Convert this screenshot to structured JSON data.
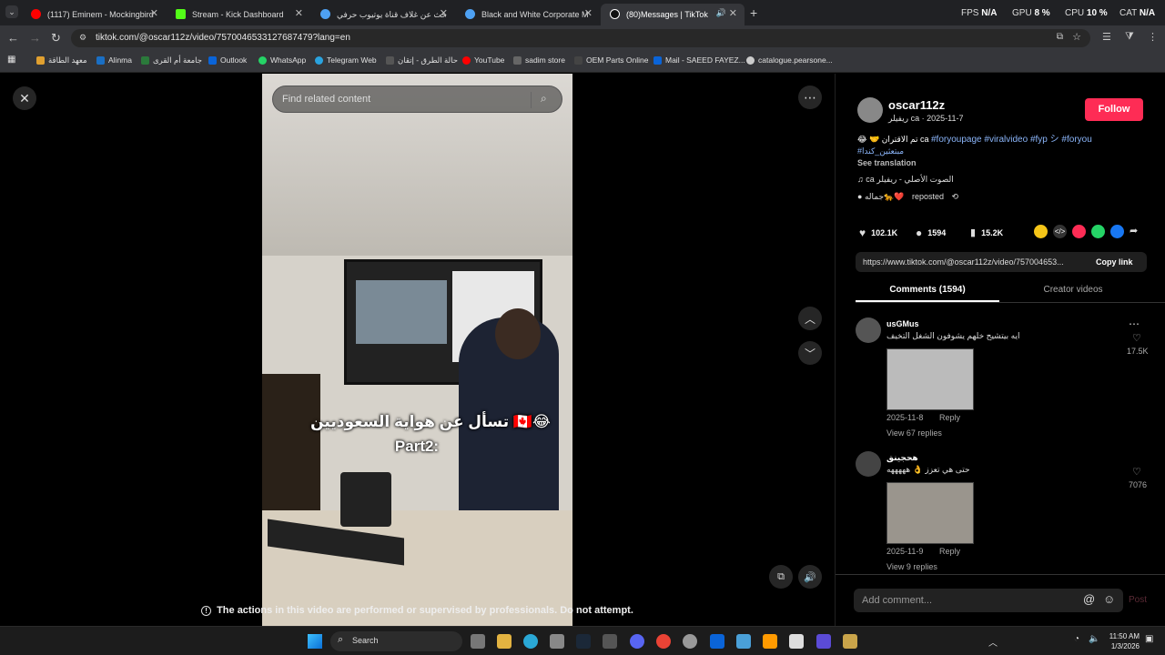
{
  "browser": {
    "tabs": [
      {
        "label": "(1117) Eminem - Mockingbird",
        "favicon_color": "#ff0000"
      },
      {
        "label": "Stream - Kick Dashboard",
        "favicon_color": "#53fc18"
      },
      {
        "label": "بحث عن غلاف قناة يوتيوب حرفي",
        "favicon_color": "#4ea1f3"
      },
      {
        "label": "Black and White Corporate M",
        "favicon_color": "#4ea1f3"
      },
      {
        "label": "(80)Messages | TikTok",
        "favicon_color": "#ffffff"
      }
    ],
    "new_tab": "+",
    "stats": {
      "fps_label": "FPS",
      "fps_value": "N/A",
      "gpu_label": "GPU",
      "gpu_value": "8 %",
      "cpu_label": "CPU",
      "cpu_value": "10 %",
      "cat_label": "CAT",
      "cat_value": "N/A"
    },
    "url": "tiktok.com/@oscar112z/video/7570046533127687479?lang=en",
    "bookmarks": [
      {
        "label": "معهد الطاقة",
        "color": "#e0a030"
      },
      {
        "label": "Alinma",
        "color": "#1a6fc4"
      },
      {
        "label": "جامعة أم القرى",
        "color": "#2b7a3b"
      },
      {
        "label": "Outlook",
        "color": "#0a64d8"
      },
      {
        "label": "WhatsApp",
        "color": "#25d366"
      },
      {
        "label": "Telegram Web",
        "color": "#2aa3df"
      },
      {
        "label": "حالة الطرق - إتقان",
        "color": "#555"
      },
      {
        "label": "YouTube",
        "color": "#ff0000"
      },
      {
        "label": "sadim store",
        "color": "#666"
      },
      {
        "label": "OEM Parts Online",
        "color": "#444"
      },
      {
        "label": "Mail - SAEED FAYEZ...",
        "color": "#0a64d8"
      },
      {
        "label": "catalogue.pearsone...",
        "color": "#ccc"
      }
    ]
  },
  "player": {
    "search_placeholder": "Find related content",
    "caption_line1": "تسأل عن هواية السعوديين 🇨🇦😂",
    "caption_line2": "Part2:",
    "warning": "The actions in this video are performed or supervised by professionals. Do not attempt."
  },
  "post": {
    "username": "oscar112z",
    "subtitle": "ريفيلر ca · 2025-11-7",
    "follow_label": "Follow",
    "caption_arabic": "😂 🤝 تم الاقتران ca",
    "hashtags": "#foryoupage #viralvideo #fyp シ #foryou",
    "hashtag_extra": "#مبتعثين_كندا",
    "see_translation": "See translation",
    "sound": "♫  ca الصوت الأصلي - ريفيلر",
    "reposted_by": "جماله🐆❤️",
    "reposted_label": "reposted",
    "likes": "102.1K",
    "comments": "1594",
    "saves": "15.2K",
    "link": "https://www.tiktok.com/@oscar112z/video/757004653...",
    "copy_link": "Copy link",
    "tab_comments": "Comments (1594)",
    "tab_creator": "Creator videos"
  },
  "comments": [
    {
      "user": "usGMus",
      "text": "ايه بيتشيح خلهم يشوفون الشغل التخيف",
      "date": "2025-11-8",
      "reply": "Reply",
      "likes": "17.5K",
      "view_replies": "View 67 replies"
    },
    {
      "user": "ﻫﺤﺠﻴﻨﻖ",
      "text": "حتى هي تعزز 👌 هههههه",
      "date": "2025-11-9",
      "reply": "Reply",
      "likes": "7076",
      "view_replies": "View 9 replies"
    }
  ],
  "add_comment_placeholder": "Add comment...",
  "post_label": "Post",
  "taskbar": {
    "search_label": "Search",
    "time": "11:50 AM",
    "date": "1/3/2026"
  },
  "colors": {
    "tiktok_red": "#fe2c55",
    "link_blue": "#8ab4f8"
  }
}
